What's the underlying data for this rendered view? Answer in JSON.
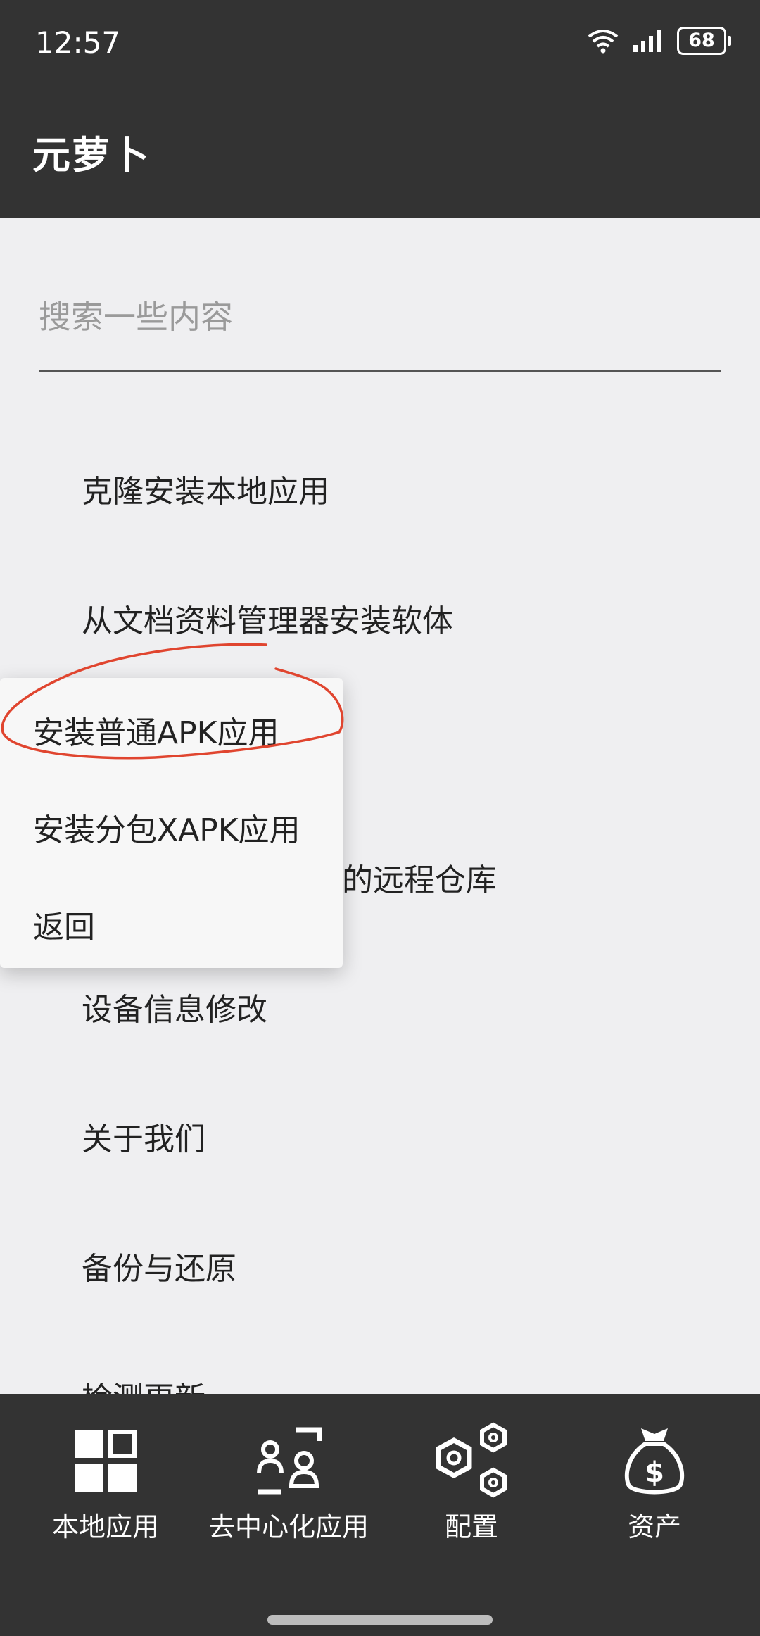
{
  "status": {
    "time": "12:57",
    "battery": "68"
  },
  "app_bar": {
    "title": "元萝卜"
  },
  "search": {
    "placeholder": "搜索一些内容"
  },
  "menu": {
    "items": [
      "克隆安装本地应用",
      "从文档资料管理器安装软体",
      "的远程仓库",
      "设备信息修改",
      "关于我们",
      "备份与还原",
      "检测更新"
    ]
  },
  "popup": {
    "items": [
      "安装普通APK应用",
      "安装分包XAPK应用",
      "返回"
    ]
  },
  "bottom_nav": {
    "items": [
      {
        "label": "本地应用",
        "icon": "grid-icon"
      },
      {
        "label": "去中心化应用",
        "icon": "users-scan-icon"
      },
      {
        "label": "配置",
        "icon": "hexagon-settings-icon"
      },
      {
        "label": "资产",
        "icon": "money-bag-icon"
      }
    ]
  },
  "colors": {
    "bar": "#333333",
    "background": "#efeff1",
    "annotation": "#e0452f"
  }
}
